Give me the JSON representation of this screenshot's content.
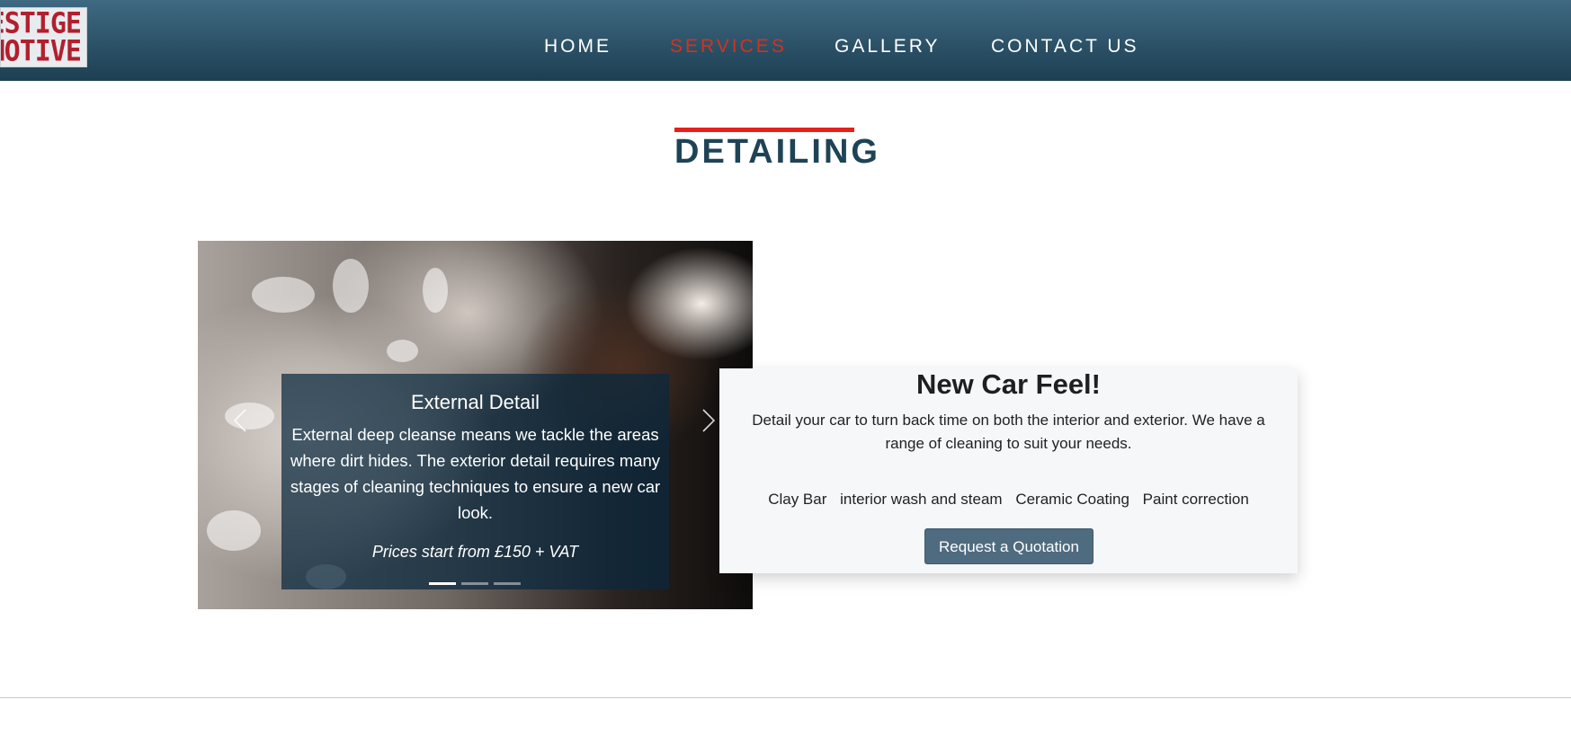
{
  "logo": {
    "line1": "ESTIGE",
    "line2": "MOTIVE"
  },
  "nav": {
    "items": [
      {
        "label": "HOME",
        "active": false
      },
      {
        "label": "SERVICES",
        "active": true
      },
      {
        "label": "GALLERY",
        "active": false
      },
      {
        "label": "CONTACT US",
        "active": false
      }
    ]
  },
  "section": {
    "title": "DETAILING"
  },
  "carousel": {
    "slide": {
      "title": "External Detail",
      "text": "External deep cleanse means we tackle the areas where dirt hides. The exterior detail requires many stages of cleaning techniques to ensure a new car look.",
      "price": "Prices start from £150 + VAT"
    },
    "slide_count": 3,
    "active_index": 0
  },
  "card": {
    "title": "New Car Feel!",
    "description": "Detail your car to turn back time on both the interior and exterior. We have a range of cleaning to suit your needs.",
    "tags": [
      "Clay Bar",
      "interior wash and steam",
      "Ceramic Coating",
      "Paint correction"
    ],
    "button_label": "Request a Quotation"
  },
  "colors": {
    "header": "#2c5268",
    "nav_active": "#d3321f",
    "title_accent": "#e8201a",
    "title_text": "#1e4356",
    "button": "#4f6b80"
  }
}
